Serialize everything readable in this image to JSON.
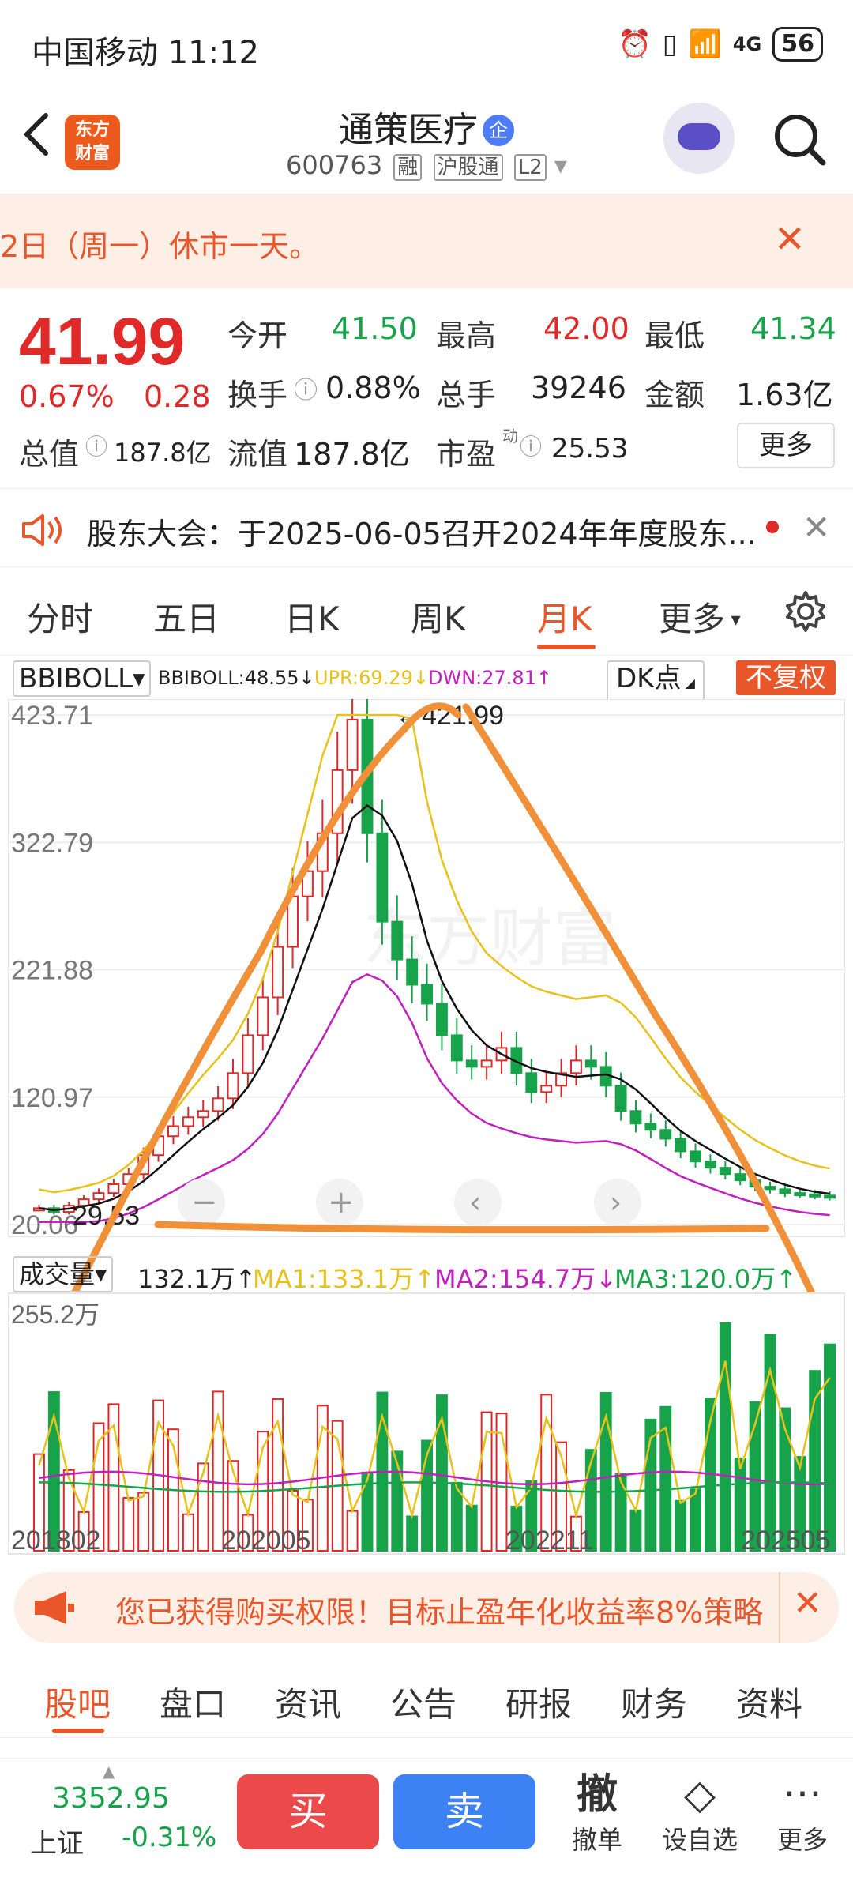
{
  "status_bar": {
    "carrier": "中国移动 11:12",
    "battery": "56",
    "network": "4G"
  },
  "header": {
    "broker_logo": "东方\n财富",
    "stock_name": "通策医疗",
    "badge": "企",
    "code": "600763",
    "tags": [
      "融",
      "沪股通",
      "L2"
    ]
  },
  "notice": {
    "text": "2日（周一）休市一天。"
  },
  "quote": {
    "price": "41.99",
    "change_pct": "0.67%",
    "change": "0.28",
    "open_label": "今开",
    "open": "41.50",
    "high_label": "最高",
    "high": "42.00",
    "low_label": "最低",
    "low": "41.34",
    "turnover_label": "换手",
    "turnover": "0.88%",
    "volume_label": "总手",
    "volume": "39246",
    "amount_label": "金额",
    "amount": "1.63亿",
    "mktcap_label": "总值",
    "mktcap": "187.8亿",
    "float_label": "流值",
    "float": "187.8亿",
    "pe_label": "市盈",
    "pe_sup": "动",
    "pe": "25.53",
    "more": "更多"
  },
  "announcement": {
    "text": "股东大会：于2025-06-05召开2024年年度股东..."
  },
  "chart_tabs": [
    "分时",
    "五日",
    "日K",
    "周K",
    "月K",
    "更多"
  ],
  "chart_tabs_active": "月K",
  "indicator": {
    "name": "BBIBOLL",
    "bbiboll": "BBIBOLL:48.55↓",
    "upr": "UPR:69.29↓",
    "dwn": "DWN:27.81↑",
    "dk": "DK点",
    "adjust": "不复权"
  },
  "chart_data": {
    "type": "candlestick",
    "y_ticks": [
      "423.71",
      "322.79",
      "221.88",
      "120.97",
      "20.06"
    ],
    "x_ticks": [
      "201802",
      "202005",
      "202211",
      "202505"
    ],
    "high_annotation": "←421.99",
    "low_annotation": "29.53",
    "ylim": [
      20.06,
      423.71
    ],
    "close_series_approx": [
      33,
      30,
      35,
      40,
      45,
      52,
      60,
      75,
      90,
      98,
      105,
      110,
      120,
      140,
      170,
      200,
      240,
      280,
      300,
      330,
      380,
      420,
      330,
      260,
      230,
      210,
      195,
      170,
      150,
      145,
      150,
      160,
      140,
      125,
      130,
      140,
      150,
      145,
      130,
      110,
      100,
      95,
      88,
      78,
      70,
      65,
      60,
      55,
      50,
      48,
      45,
      44,
      43,
      42
    ],
    "series": [
      {
        "name": "BBIBOLL",
        "color": "#111111"
      },
      {
        "name": "UPR",
        "color": "#e8c21a"
      },
      {
        "name": "DWN",
        "color": "#c21fbf"
      }
    ]
  },
  "volume": {
    "label": "成交量",
    "value": "132.1万↑",
    "ma1": "MA1:133.1万↑",
    "ma2": "MA2:154.7万↓",
    "ma3": "MA3:120.0万↑",
    "y_max": "255.2万"
  },
  "ad_banner": {
    "text": "您已获得购买权限！目标止盈年化收益率8%策略"
  },
  "bottom_tabs": [
    "股吧",
    "盘口",
    "资讯",
    "公告",
    "研报",
    "财务",
    "资料"
  ],
  "bottom_bar": {
    "index_value": "3352.95",
    "index_name": "上证",
    "index_change": "-0.31%",
    "buy": "买",
    "sell": "卖",
    "tools": [
      {
        "icon": "撤",
        "label": "撤单"
      },
      {
        "icon": "◇",
        "label": "设自选"
      },
      {
        "icon": "···",
        "label": "更多"
      }
    ]
  },
  "colors": {
    "up": "#e02a2a",
    "down": "#16a34a",
    "accent": "#e8562a"
  }
}
